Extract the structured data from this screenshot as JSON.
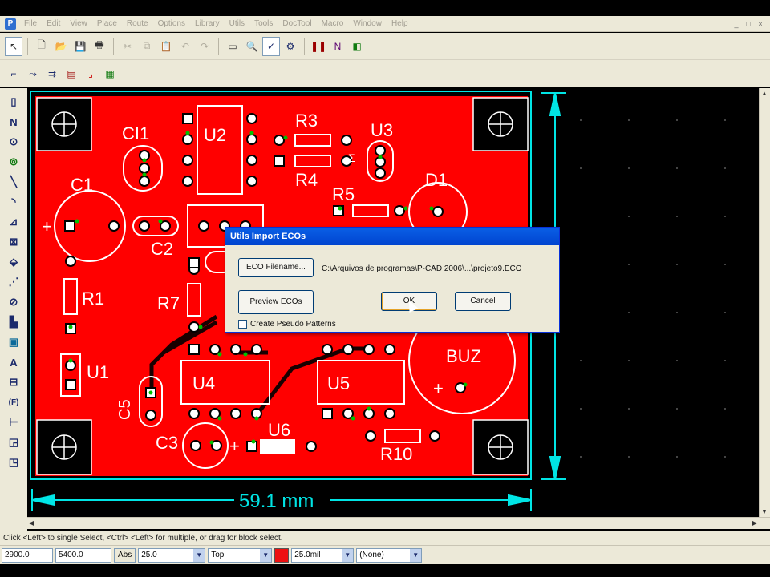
{
  "menu": {
    "items": [
      "File",
      "Edit",
      "View",
      "Place",
      "Route",
      "Options",
      "Library",
      "Utils",
      "Tools",
      "DocTool",
      "Macro",
      "Window",
      "Help"
    ],
    "mdi_controls": [
      "_",
      "□",
      "×"
    ]
  },
  "pcb": {
    "labels": {
      "ci1": "CI1",
      "u2": "U2",
      "r3": "R3",
      "u3": "U3",
      "c1": "C1",
      "r4": "R4",
      "r5": "R5",
      "d1": "D1",
      "c2": "C2",
      "r1": "R1",
      "r7": "R7",
      "u1": "U1",
      "u4": "U4",
      "u5": "U5",
      "buz": "BUZ",
      "c5": "C5",
      "c3": "C3",
      "u6": "U6",
      "r10": "R10",
      "plus_c1": "+",
      "plus_buz": "+",
      "plus_c3": "+",
      "dimension": "59.1 mm",
      "side_mark": "Σ"
    },
    "colors": {
      "board": "#ff0000",
      "outline": "#00e5e5",
      "pad": "#ffffff",
      "via": "#00c000",
      "background": "#000000"
    }
  },
  "dialog": {
    "title": "Utils Import ECOs",
    "eco_filename_button": "ECO Filename...",
    "path": "C:\\Arquivos de programas\\P-CAD 2006\\...\\projeto9.ECO",
    "preview_button": "Preview ECOs",
    "ok_button": "OK",
    "cancel_button": "Cancel",
    "checkbox_label": "Create Pseudo Patterns",
    "checkbox_checked": false
  },
  "status": {
    "hint": "Click <Left> to single Select, <Ctrl> <Left> for multiple, or drag for block select.",
    "x_coord": "2900.0",
    "y_coord": "5400.0",
    "abs_label": "Abs",
    "grid": "25.0",
    "layer": "Top",
    "layer_color": "#ee1111",
    "line_width": "25.0mil",
    "net": "(None)"
  }
}
